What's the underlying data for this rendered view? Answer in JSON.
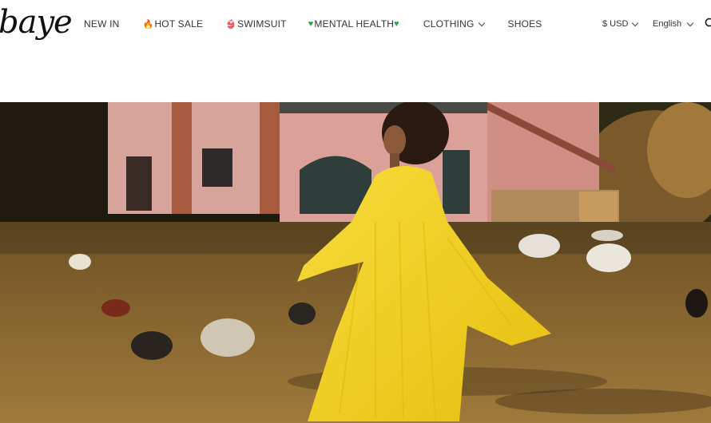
{
  "brand": {
    "logo_text": "baye"
  },
  "nav": {
    "items": [
      {
        "label": "NEW IN",
        "icon": "",
        "has_dropdown": false
      },
      {
        "label": "HOT SALE",
        "icon": "fire-icon",
        "has_dropdown": false
      },
      {
        "label": "SWIMSUIT",
        "icon": "swimsuit-icon",
        "has_dropdown": false
      },
      {
        "label": "MENTAL HEALTH",
        "icon": "green-heart-icon",
        "has_dropdown": false
      },
      {
        "label": "CLOTHING",
        "icon": "",
        "has_dropdown": true
      },
      {
        "label": "SHOES",
        "icon": "",
        "has_dropdown": false
      }
    ]
  },
  "utility": {
    "currency": "$ USD",
    "language": "English"
  },
  "hero": {
    "colors": {
      "sky": "#1a1a10",
      "building": "#d49a92",
      "ground": "#8c6a32",
      "dress": "#f3d21a"
    }
  }
}
